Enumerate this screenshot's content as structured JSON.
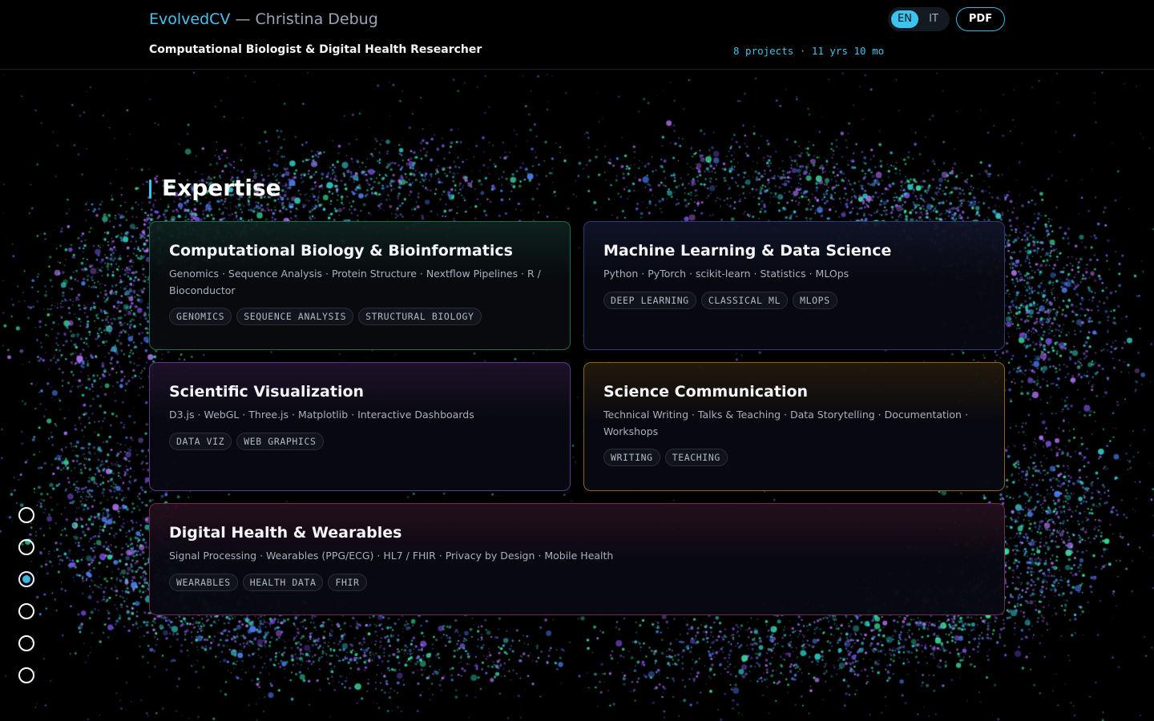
{
  "header": {
    "brand": "EvolvedCV",
    "separator": " — ",
    "person": "Christina Debug",
    "subtitle": "Computational Biologist & Digital Health Researcher",
    "stats": "8 projects · 11 yrs 10 mo",
    "lang_en": "EN",
    "lang_it": "IT",
    "active_lang": "EN",
    "pdf_label": "PDF"
  },
  "section": {
    "title": "Expertise"
  },
  "cards": [
    {
      "title": "Computational Biology & Bioinformatics",
      "desc": "Genomics · Sequence Analysis · Protein Structure · Nextflow Pipelines · R / Bioconductor",
      "tags": [
        "GENOMICS",
        "SEQUENCE ANALYSIS",
        "STRUCTURAL BIOLOGY"
      ],
      "accent": "#1f6b52"
    },
    {
      "title": "Machine Learning & Data Science",
      "desc": "Python · PyTorch · scikit-learn · Statistics · MLOps",
      "tags": [
        "DEEP LEARNING",
        "CLASSICAL ML",
        "MLOPS"
      ],
      "accent": "#2f3c73"
    },
    {
      "title": "Scientific Visualization",
      "desc": "D3.js · WebGL · Three.js · Matplotlib · Interactive Dashboards",
      "tags": [
        "DATA VIZ",
        "WEB GRAPHICS"
      ],
      "accent": "#5c3a86"
    },
    {
      "title": "Science Communication",
      "desc": "Technical Writing · Talks & Teaching · Data Storytelling · Documentation · Workshops",
      "tags": [
        "WRITING",
        "TEACHING"
      ],
      "accent": "#8a6420"
    },
    {
      "title": "Digital Health & Wearables",
      "desc": "Signal Processing · Wearables (PPG/ECG) · HL7 / FHIR · Privacy by Design · Mobile Health",
      "tags": [
        "WEARABLES",
        "HEALTH DATA",
        "FHIR"
      ],
      "accent": "#6a2e52"
    }
  ],
  "side_nav": {
    "count": 6,
    "active_index": 2
  },
  "colors": {
    "accent": "#3cc4ee",
    "background": "#000000",
    "particles": [
      "#2fd0c8",
      "#7a4ee0",
      "#4a7cf0",
      "#39e0a0",
      "#b070f0"
    ]
  }
}
